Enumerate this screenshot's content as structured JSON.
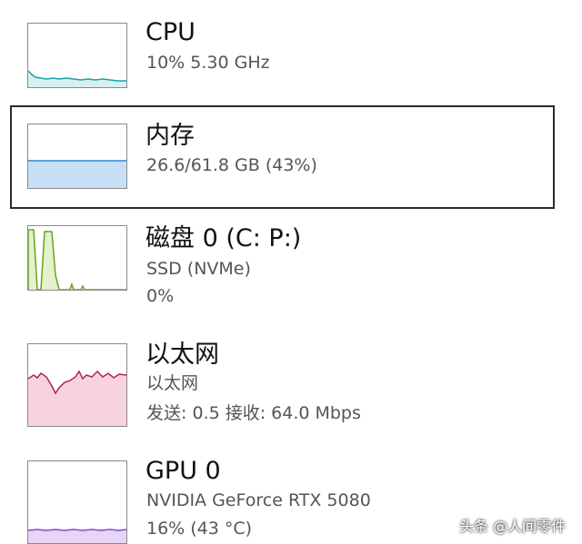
{
  "items": [
    {
      "title": "CPU",
      "line1": "10% 5.30 GHz",
      "line2": "",
      "color": "#17a2a8"
    },
    {
      "title": "内存",
      "line1": "26.6/61.8 GB (43%)",
      "line2": "",
      "color": "#2a87d4"
    },
    {
      "title": "磁盘 0 (C: P:)",
      "line1": "SSD (NVMe)",
      "line2": "0%",
      "color": "#6aa323"
    },
    {
      "title": "以太网",
      "line1": "以太网",
      "line2": "发送: 0.5 接收: 64.0 Mbps",
      "color": "#b0234f"
    },
    {
      "title": "GPU 0",
      "line1": "NVIDIA GeForce RTX 5080",
      "line2": "16% (43 °C)",
      "color": "#8a47c9"
    }
  ],
  "memory_usage_fraction": 0.43,
  "watermark": "头条 @人间零件"
}
